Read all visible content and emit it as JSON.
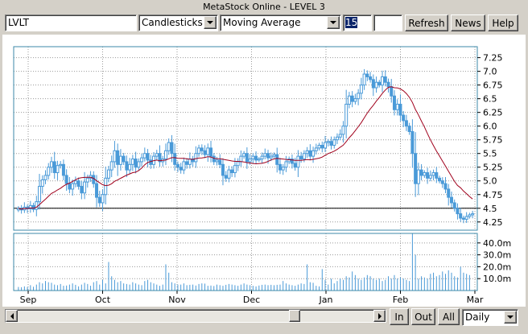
{
  "window_title": "MetaStock Online - LEVEL 3",
  "toolbar": {
    "symbol_value": "LVLT",
    "chart_type_value": "Candlesticks",
    "indicator_value": "Moving Average",
    "period_value": "15",
    "extra_value": "",
    "refresh_label": "Refresh",
    "news_label": "News",
    "help_label": "Help"
  },
  "bottom": {
    "in_label": "In",
    "out_label": "Out",
    "all_label": "All",
    "interval_value": "Daily"
  },
  "colors": {
    "candle": "#4a9ad8",
    "ma": "#a0001c",
    "volume": "#4a9ad8",
    "grid": "#9a9a9a",
    "frame": "#3c8aa8"
  },
  "chart_data": {
    "type": "candlestick",
    "symbol": "LVLT",
    "indicator": "Moving Average",
    "ma_period": 15,
    "x_labels": [
      "Sep",
      "Oct",
      "Nov",
      "Dec",
      "Jan",
      "Feb",
      "Mar"
    ],
    "price_ticks": [
      "7.25",
      "7.0",
      "6.75",
      "6.5",
      "6.25",
      "6.0",
      "5.75",
      "5.5",
      "5.25",
      "5.0",
      "4.75",
      "4.5",
      "4.25"
    ],
    "ylim": [
      4.1,
      7.45
    ],
    "reference_line": 4.5,
    "volume_ticks": [
      "40.0m",
      "30.0m",
      "20.0m",
      "10.0m"
    ],
    "volume_ylim": [
      0,
      48
    ],
    "close": [
      4.5,
      4.47,
      4.52,
      4.49,
      4.55,
      4.48,
      4.62,
      4.9,
      5.02,
      5.1,
      5.25,
      5.35,
      5.15,
      5.28,
      5.3,
      5.1,
      4.95,
      4.85,
      4.95,
      5.0,
      4.9,
      4.78,
      4.98,
      5.05,
      5.1,
      4.95,
      4.7,
      4.6,
      4.75,
      5.05,
      5.2,
      5.35,
      5.55,
      5.3,
      5.45,
      5.35,
      5.2,
      5.3,
      5.4,
      5.25,
      5.35,
      5.42,
      5.5,
      5.38,
      5.3,
      5.45,
      5.5,
      5.35,
      5.4,
      5.55,
      5.7,
      5.5,
      5.3,
      5.25,
      5.2,
      5.35,
      5.3,
      5.4,
      5.35,
      5.5,
      5.6,
      5.55,
      5.48,
      5.6,
      5.45,
      5.35,
      5.38,
      5.3,
      5.1,
      5.05,
      5.2,
      5.15,
      5.28,
      5.35,
      5.45,
      5.5,
      5.35,
      5.4,
      5.45,
      5.38,
      5.4,
      5.45,
      5.5,
      5.42,
      5.45,
      5.48,
      5.3,
      5.2,
      5.25,
      5.35,
      5.4,
      5.32,
      5.25,
      5.45,
      5.4,
      5.5,
      5.55,
      5.45,
      5.55,
      5.6,
      5.65,
      5.6,
      5.7,
      5.72,
      5.65,
      5.75,
      5.8,
      5.85,
      6.0,
      6.4,
      6.55,
      6.45,
      6.5,
      6.6,
      6.75,
      6.95,
      6.9,
      6.85,
      6.7,
      6.8,
      6.75,
      6.9,
      6.8,
      6.72,
      6.55,
      6.3,
      6.4,
      6.2,
      6.1,
      6.0,
      5.9,
      5.5,
      4.95,
      5.2,
      5.1,
      5.15,
      5.05,
      5.1,
      5.15,
      5.05,
      5.0,
      4.95,
      4.85,
      4.7,
      4.6,
      4.5,
      4.4,
      4.32,
      4.3,
      4.35,
      4.38,
      4.4
    ],
    "volume_m": [
      3,
      2.8,
      3.5,
      3,
      4.5,
      3.2,
      5,
      7,
      6,
      8,
      7,
      6.5,
      5,
      4.5,
      5.5,
      4,
      4.2,
      5,
      6,
      4.8,
      3.5,
      5,
      6.5,
      5.5,
      4,
      7,
      8,
      5,
      9,
      6,
      24,
      12,
      9,
      7,
      8,
      6,
      5.5,
      5,
      7,
      6,
      5,
      4.5,
      8,
      9,
      7,
      6,
      5,
      4,
      5,
      22,
      15,
      7,
      6,
      5,
      5,
      6,
      4.5,
      4.8,
      5,
      4.2,
      5.5,
      6,
      5.8,
      4,
      4.2,
      3.8,
      5,
      4.5,
      4,
      4.8,
      5.5,
      5,
      4.5,
      4,
      5,
      6,
      5,
      4.5,
      4,
      3.5,
      4.2,
      4.8,
      5,
      4.5,
      4.8,
      4.5,
      4.8,
      5,
      8,
      6,
      5,
      4.5,
      4,
      5,
      6,
      5.5,
      22,
      7,
      6.5,
      4,
      3.5,
      18,
      9,
      5,
      10,
      6,
      8,
      10,
      9,
      12,
      11,
      16,
      13,
      10,
      9,
      11,
      13,
      12,
      10,
      9,
      10,
      8,
      9,
      12,
      10,
      13,
      10,
      11,
      10,
      9,
      8,
      48,
      30,
      10,
      12,
      11,
      10,
      14,
      15,
      12,
      13,
      16,
      14,
      17,
      15,
      12,
      11,
      20,
      15,
      14,
      13
    ]
  }
}
